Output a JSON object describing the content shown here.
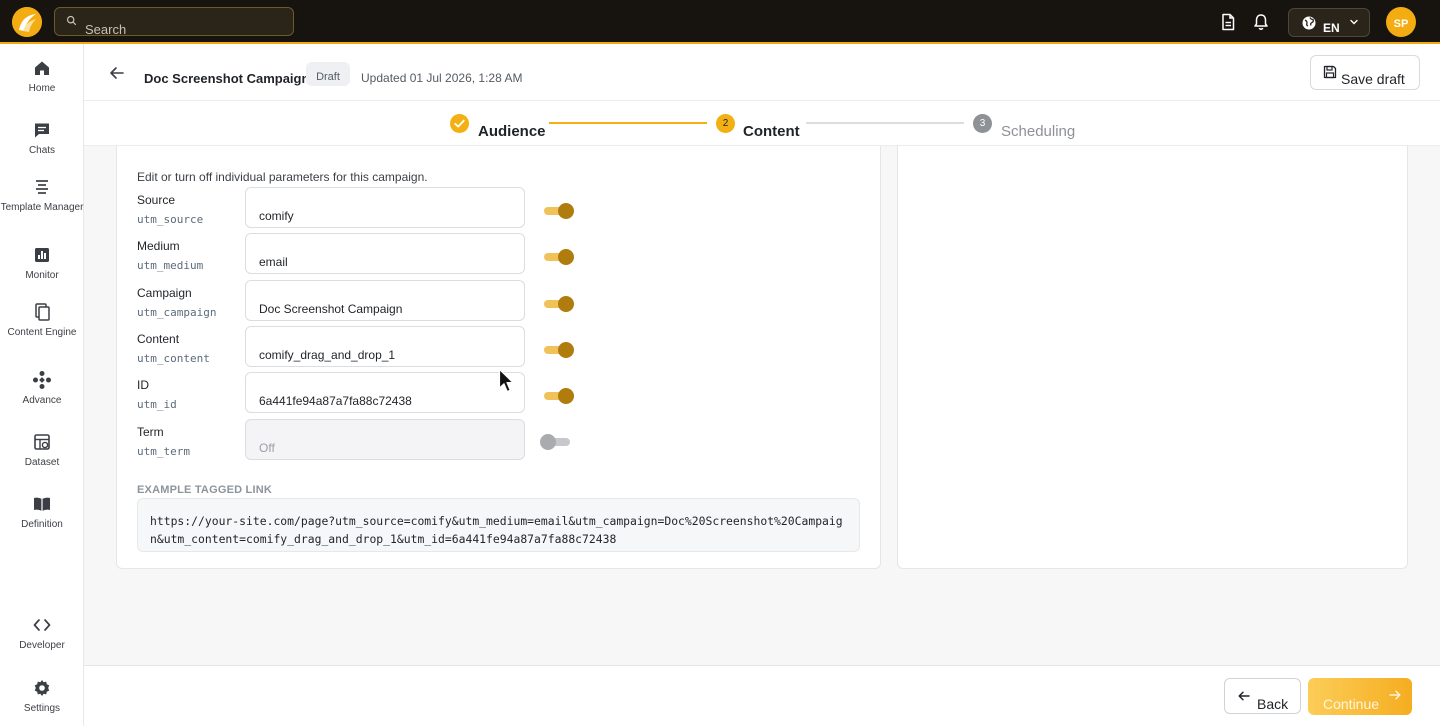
{
  "topbar": {
    "search_placeholder": "Search",
    "language": "EN",
    "avatar_initials": "SP",
    "brand_color": "#f3ad12"
  },
  "sidebar": {
    "items": [
      {
        "label": "Home",
        "icon": "home-icon"
      },
      {
        "label": "Chats",
        "icon": "chat-icon"
      },
      {
        "label": "Template Manager",
        "icon": "template-icon"
      },
      {
        "label": "Monitor",
        "icon": "monitor-icon"
      },
      {
        "label": "Content Engine",
        "icon": "content-engine-icon"
      },
      {
        "label": "Advance",
        "icon": "advance-icon"
      },
      {
        "label": "Dataset",
        "icon": "dataset-icon"
      },
      {
        "label": "Definition",
        "icon": "definition-icon"
      }
    ],
    "bottom_items": [
      {
        "label": "Developer",
        "icon": "code-icon"
      },
      {
        "label": "Settings",
        "icon": "gear-icon"
      }
    ]
  },
  "header": {
    "campaign_title": "Doc Screenshot Campaign",
    "status": "Draft",
    "updated": "Updated 01 Jul 2026, 1:28 AM",
    "save_draft": "Save draft"
  },
  "stepper": {
    "steps": [
      {
        "number": "1",
        "label": "Audience",
        "state": "complete"
      },
      {
        "number": "2",
        "label": "Content",
        "state": "active"
      },
      {
        "number": "3",
        "label": "Scheduling",
        "state": "upcoming"
      }
    ]
  },
  "utm": {
    "intro": "Edit or turn off individual parameters for this campaign.",
    "params": [
      {
        "label": "Source",
        "key": "utm_source",
        "value": "comify",
        "placeholder": "",
        "enabled": true
      },
      {
        "label": "Medium",
        "key": "utm_medium",
        "value": "email",
        "placeholder": "",
        "enabled": true
      },
      {
        "label": "Campaign",
        "key": "utm_campaign",
        "value": "Doc Screenshot Campaign",
        "placeholder": "",
        "enabled": true
      },
      {
        "label": "Content",
        "key": "utm_content",
        "value": "comify_drag_and_drop_1",
        "placeholder": "",
        "enabled": true
      },
      {
        "label": "ID",
        "key": "utm_id",
        "value": "6a441fe94a87a7fa88c72438",
        "placeholder": "",
        "enabled": true
      },
      {
        "label": "Term",
        "key": "utm_term",
        "value": "",
        "placeholder": "Off",
        "enabled": false
      }
    ],
    "example_label": "EXAMPLE TAGGED LINK",
    "example_link": "https://your-site.com/page?utm_source=comify&utm_medium=email&utm_campaign=Doc%20Screenshot%20Campaign&utm_content=comify_drag_and_drop_1&utm_id=6a441fe94a87a7fa88c72438"
  },
  "footer": {
    "back": "Back",
    "continue": "Continue"
  }
}
